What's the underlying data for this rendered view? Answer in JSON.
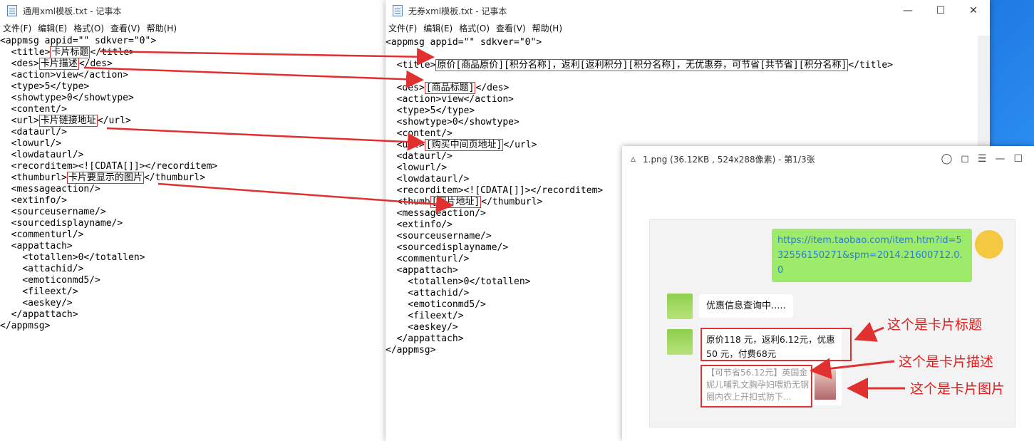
{
  "notepad_menu": [
    "文件(F)",
    "编辑(E)",
    "格式(O)",
    "查看(V)",
    "帮助(H)"
  ],
  "left_window": {
    "title": "通用xml模板.txt - 记事本",
    "lines": [
      [
        "<appmsg appid=\"\" sdkver=\"0\">"
      ],
      [
        "  <title>",
        {
          "hl": "卡片标题"
        },
        "</title>"
      ],
      [
        "  <des>",
        {
          "hl": "卡片描述"
        },
        "</des>"
      ],
      [
        "  <action>view</action>"
      ],
      [
        "  <type>5</type>"
      ],
      [
        "  <showtype>0</showtype>"
      ],
      [
        "  <content/>"
      ],
      [
        "  <url>",
        {
          "hl": "卡片链接地址"
        },
        "</url>"
      ],
      [
        "  <dataurl/>"
      ],
      [
        "  <lowurl/>"
      ],
      [
        "  <lowdataurl/>"
      ],
      [
        "  <recorditem><![CDATA[]]></recorditem>"
      ],
      [
        "  <thumburl>",
        {
          "hl": "卡片要显示的图片"
        },
        "</thumburl>"
      ],
      [
        "  <messageaction/>"
      ],
      [
        "  <extinfo/>"
      ],
      [
        "  <sourceusername/>"
      ],
      [
        "  <sourcedisplayname/>"
      ],
      [
        "  <commenturl/>"
      ],
      [
        "  <appattach>"
      ],
      [
        "    <totallen>0</totallen>"
      ],
      [
        "    <attachid/>"
      ],
      [
        "    <emoticonmd5/>"
      ],
      [
        "    <fileext/>"
      ],
      [
        "    <aeskey/>"
      ],
      [
        "  </appattach>"
      ],
      [
        "</appmsg>"
      ]
    ]
  },
  "right_window": {
    "title": "无券xml模板.txt - 记事本",
    "lines": [
      [
        "<appmsg appid=\"\" sdkver=\"0\">"
      ],
      [
        "  <title>",
        {
          "hl": "原价[商品原价][积分名称]，返利[返利积分][积分名称]，无优惠券，可节省[共节省][积分名称]"
        },
        "</title>"
      ],
      [
        "  <des>",
        {
          "hl": "[商品标题]"
        },
        "</des>"
      ],
      [
        "  <action>view</action>"
      ],
      [
        "  <type>5</type>"
      ],
      [
        "  <showtype>0</showtype>"
      ],
      [
        "  <content/>"
      ],
      [
        "  <url>",
        {
          "hl": "[购买中间页地址]"
        },
        "</url>"
      ],
      [
        "  <dataurl/>"
      ],
      [
        "  <lowurl/>"
      ],
      [
        "  <lowdataurl/>"
      ],
      [
        "  <recorditem><![CDATA[]]></recorditem>"
      ],
      [
        "  <thumb",
        {
          "hl": "[图片地址]"
        },
        "</thumburl>"
      ],
      [
        "  <messageaction/>"
      ],
      [
        "  <extinfo/>"
      ],
      [
        "  <sourceusername/>"
      ],
      [
        "  <sourcedisplayname/>"
      ],
      [
        "  <commenturl/>"
      ],
      [
        "  <appattach>"
      ],
      [
        "    <totallen>0</totallen>"
      ],
      [
        "    <attachid/>"
      ],
      [
        "    <emoticonmd5/>"
      ],
      [
        "    <fileext/>"
      ],
      [
        "    <aeskey/>"
      ],
      [
        "  </appattach>"
      ],
      [
        "</appmsg>"
      ]
    ]
  },
  "viewer": {
    "title": "1.png (36.12KB , 524x288像素) - 第1/3张",
    "link_text": "https://item.taobao.com/item.htm?id=532556150271&spm=2014.21600712.0.0",
    "query_text": "优惠信息查询中.....",
    "card_title": "原价118 元，返利6.12元，优惠50 元，付费68元",
    "card_desc": "【可节省56.12元】英国金妮儿哺乳文胸孕妇喂奶无钢圈内衣上开扣式防下...",
    "note_title": "这个是卡片标题",
    "note_desc": "这个是卡片描述",
    "note_image": "这个是卡片图片"
  },
  "colors": {
    "red": "#e03030",
    "green_bubble": "#9eea6a",
    "link": "#2a7fcf"
  }
}
